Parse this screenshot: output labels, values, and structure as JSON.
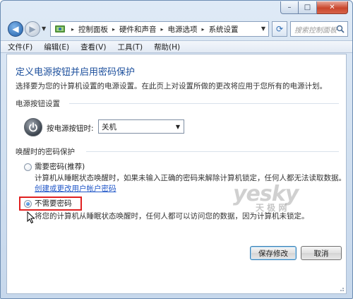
{
  "window": {
    "caption_buttons": [
      "–",
      "□",
      "✕"
    ]
  },
  "nav": {
    "breadcrumbs": [
      "控制面板",
      "硬件和声音",
      "电源选项",
      "系统设置"
    ],
    "search_placeholder": "搜索控制面板"
  },
  "menu": [
    "文件(F)",
    "编辑(E)",
    "查看(V)",
    "工具(T)",
    "帮助(H)"
  ],
  "page": {
    "title": "定义电源按钮并启用密码保护",
    "description": "选择要为您的计算机设置的电源设置。在此页上对设置所做的更改将应用于您所有的电源计划。"
  },
  "power_section": {
    "title": "电源按钮设置",
    "label": "按电源按钮时:",
    "selected": "关机"
  },
  "wake_section": {
    "title": "唤醒时的密码保护",
    "option_require": {
      "label": "需要密码(推荐)",
      "description": "计算机从睡眠状态唤醒时，如果未输入正确的密码来解除计算机锁定，任何人都无法读取数据。",
      "link": "创建或更改用户帐户密码",
      "checked": false
    },
    "option_none": {
      "label": "不需要密码",
      "description": "将您的计算机从睡眠状态唤醒时，任何人都可以访问您的数据，因为计算机未锁定。",
      "checked": true
    }
  },
  "buttons": {
    "save": "保存修改",
    "cancel": "取消"
  },
  "watermark": {
    "main": "yesky",
    "sub": "天 极 网"
  },
  "colors": {
    "title_blue": "#1c4f9c",
    "link_blue": "#1f56c8",
    "highlight_red": "#e02020"
  }
}
